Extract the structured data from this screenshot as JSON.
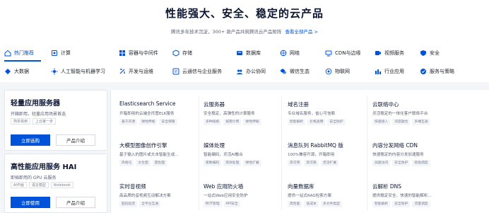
{
  "hero": {
    "title": "性能强大、安全、稳定的云产品",
    "subtitle": "腾讯多年技术沉淀，300+ 款产品共筑腾讯云产品矩阵",
    "link": "查看全部产品 >"
  },
  "nav": {
    "row1": [
      {
        "label": "热门推荐",
        "icon": "home-icon",
        "active": true
      },
      {
        "label": "计算",
        "icon": "compute-icon"
      },
      {
        "label": "容器与中间件",
        "icon": "container-icon"
      },
      {
        "label": "存储",
        "icon": "storage-icon"
      },
      {
        "label": "数据库",
        "icon": "database-icon"
      },
      {
        "label": "网络",
        "icon": "network-icon"
      },
      {
        "label": "CDN与边缘",
        "icon": "cdn-icon"
      },
      {
        "label": "视频服务",
        "icon": "video-icon"
      },
      {
        "label": "安全",
        "icon": "shield-icon"
      }
    ],
    "row2": [
      {
        "label": "大数据",
        "icon": "bigdata-icon"
      },
      {
        "label": "人工智能与机器学习",
        "icon": "ai-icon"
      },
      {
        "label": "开发与运维",
        "icon": "devops-icon"
      },
      {
        "label": "云通信与企业服务",
        "icon": "communication-icon"
      },
      {
        "label": "办公协同",
        "icon": "office-icon"
      },
      {
        "label": "微信生态",
        "icon": "wechat-icon"
      },
      {
        "label": "物联网",
        "icon": "iot-icon"
      },
      {
        "label": "行业应用",
        "icon": "industry-icon"
      },
      {
        "label": "服务与策略",
        "icon": "service-icon"
      }
    ]
  },
  "featured": [
    {
      "title": "轻量应用服务器",
      "desc": "开箱即用，轻量应用场景首选",
      "tags": [
        "简单易用",
        "上云第一步"
      ],
      "primary": "立即选购",
      "secondary": "产品介绍"
    },
    {
      "title": "高性能应用服务 HAI",
      "desc": "即插即用的 GPU 云服务",
      "tags": [
        "AI作画",
        "语言模型",
        "Notebook"
      ],
      "primary": "立即使用",
      "secondary": "产品介绍"
    }
  ],
  "products": [
    {
      "name": "Elasticsearch Service",
      "desc": "开箱即用的云端全托管ELK服务",
      "tags": [
        "基于开源",
        "弹性伸缩",
        "安全保障"
      ]
    },
    {
      "name": "云服务器",
      "desc": "安全稳定，高弹性的计算服务",
      "tags": [
        "多种规格",
        "按需计费",
        "弹性伸缩"
      ]
    },
    {
      "name": "域名注册",
      "desc": "专业域名服务，省心可信赖",
      "tags": [
        "智能解析",
        "价格透明",
        "安全防护"
      ]
    },
    {
      "name": "云联络中心",
      "desc": "灵活稳定的一体化客户联络平台",
      "tags": [
        "快速接入",
        "深度融合",
        "多端互通"
      ]
    },
    {
      "name": "大模型图像创作引擎",
      "desc": "基于输入的图片或文本智能生成...",
      "tags": [
        "风格化",
        "文生图",
        "图生图"
      ]
    },
    {
      "name": "媒体处理",
      "desc": "智能编码，灵活AI融合",
      "tags": [
        "极致编码",
        "高效处理",
        "弹性扩展"
      ]
    },
    {
      "name": "消息队列 RabbitMQ 版",
      "desc": "100%兼容开源，开箱即用",
      "tags": [
        "高可用",
        "高可靠",
        "灵活扩展"
      ]
    },
    {
      "name": "内容分发网络 CDN",
      "desc": "快速稳定的内容分发加速服务",
      "tags": [
        "加速访问",
        "安全防护",
        "智能调度"
      ]
    },
    {
      "name": "实时音视频",
      "desc": "高品质的音视频互动解决方案",
      "tags": [
        "超低延迟",
        "全平台互通"
      ]
    },
    {
      "name": "Web 应用防火墙",
      "desc": "一站式Web应用安全防护",
      "tags": [
        "BOT管理",
        "API安全"
      ]
    },
    {
      "name": "向量数据库",
      "desc": "提供一站式RAG检索方案",
      "tags": [
        "高性能",
        "低成本",
        "多文件类型"
      ]
    },
    {
      "name": "云解析 DNS",
      "desc": "提供稳定安全、快速的智能解析...",
      "tags": [
        "智能解析",
        "安全防护",
        "流量调度"
      ]
    }
  ]
}
